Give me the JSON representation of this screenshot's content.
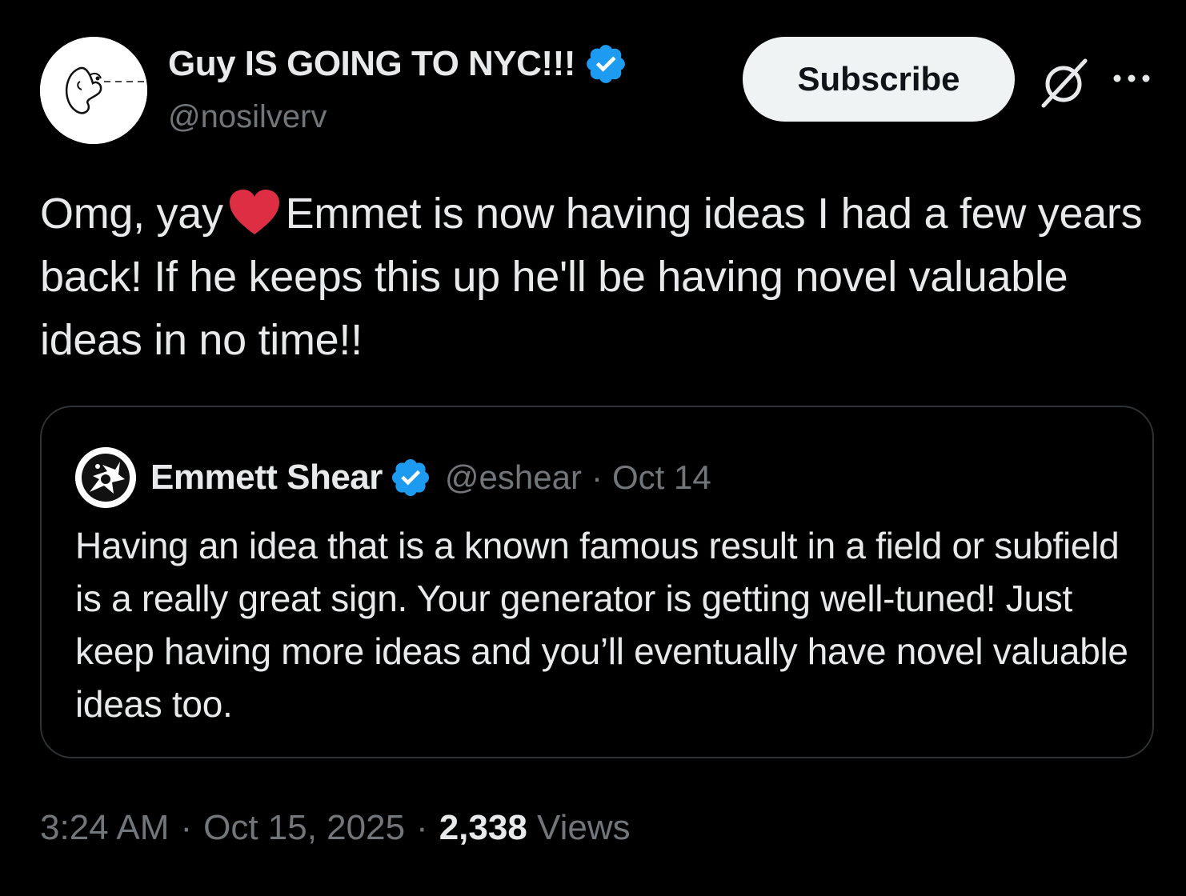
{
  "author": {
    "display_name": "Guy IS GOING TO NYC!!!",
    "handle": "@nosilverv",
    "verified_icon": "verified-badge-icon"
  },
  "actions": {
    "subscribe_label": "Subscribe",
    "grok_icon": "grok-slash-icon",
    "more_icon": "more-dots-icon"
  },
  "tweet": {
    "text_before_emoji": "Omg, yay",
    "emoji": "red-heart",
    "text_after_emoji": "Emmet is now having ideas I had a few years back! If he keeps this up he'll be having novel valuable ideas in no time!!"
  },
  "quote": {
    "display_name": "Emmett Shear",
    "handle": "@eshear",
    "separator": "·",
    "date": "Oct 14",
    "text": "Having an idea that is a known famous result in a field or subfield is a really great sign. Your generator is getting well-tuned! Just keep having more ideas and you’ll eventually have novel valuable ideas too."
  },
  "meta": {
    "time": "3:24 AM",
    "separator": "·",
    "date": "Oct 15, 2025",
    "views_count": "2,338",
    "views_label": "Views"
  },
  "colors": {
    "background": "#000000",
    "text_primary": "#e7e9ea",
    "text_secondary": "#71767b",
    "verified_blue": "#1d9bf0",
    "heart_red": "#dd2e44",
    "border": "#2f3336",
    "button_bg": "#eff3f4"
  }
}
